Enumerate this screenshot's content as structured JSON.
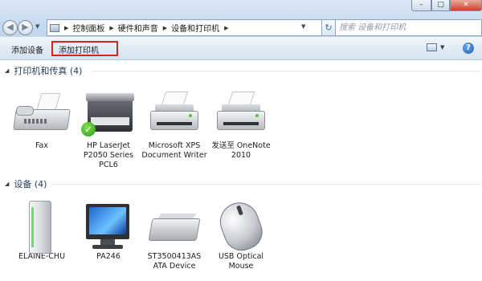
{
  "window": {
    "minimize_glyph": "–",
    "maximize_glyph": "□",
    "close_glyph": "✕"
  },
  "nav": {
    "back_glyph": "◀",
    "forward_glyph": "▶",
    "dropdown_glyph": "▼"
  },
  "address": {
    "crumbs": [
      "控制面板",
      "硬件和声音",
      "设备和打印机"
    ],
    "separator": "▶",
    "dropdown_glyph": "▼",
    "refresh_glyph": "↻"
  },
  "search": {
    "placeholder": "搜索 设备和打印机"
  },
  "toolbar": {
    "add_device": "添加设备",
    "add_printer": "添加打印机",
    "view_arrow": "▼",
    "help_glyph": "?"
  },
  "groups": {
    "printers": {
      "toggle": "◢",
      "title": "打印机和传真 (4)",
      "items": [
        {
          "label": "Fax"
        },
        {
          "label": "HP LaserJet P2050 Series PCL6",
          "default": true
        },
        {
          "label": "Microsoft XPS Document Writer"
        },
        {
          "label": "发送至 OneNote 2010"
        }
      ]
    },
    "devices": {
      "toggle": "◢",
      "title": "设备 (4)",
      "items": [
        {
          "label": "ELAINE-CHU"
        },
        {
          "label": "PA246"
        },
        {
          "label": "ST3500413AS ATA Device"
        },
        {
          "label": "USB Optical Mouse"
        }
      ]
    }
  },
  "default_badge_glyph": "✓"
}
